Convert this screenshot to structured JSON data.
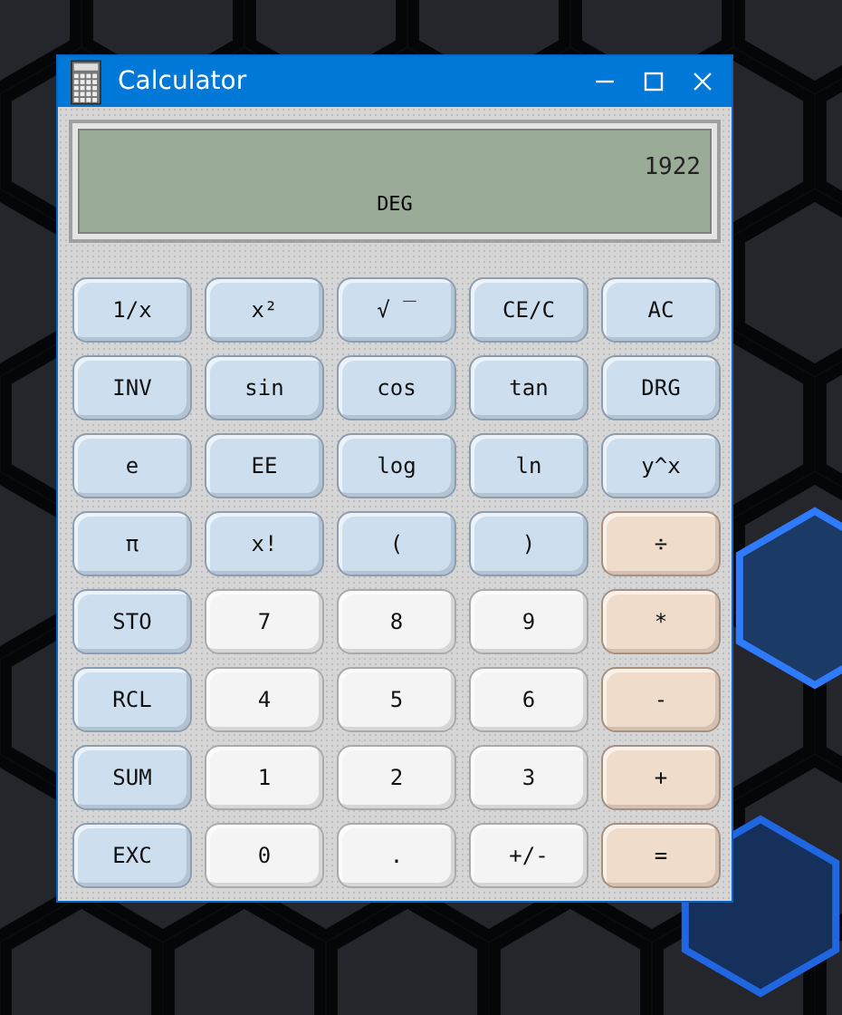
{
  "window": {
    "title": "Calculator"
  },
  "display": {
    "value": "1922",
    "mode": "DEG"
  },
  "keys": [
    {
      "label": "1/x",
      "kind": "function"
    },
    {
      "label": "x²",
      "kind": "function"
    },
    {
      "label": "√ ‾",
      "kind": "function"
    },
    {
      "label": "CE/C",
      "kind": "function"
    },
    {
      "label": "AC",
      "kind": "function"
    },
    {
      "label": "INV",
      "kind": "function"
    },
    {
      "label": "sin",
      "kind": "function"
    },
    {
      "label": "cos",
      "kind": "function"
    },
    {
      "label": "tan",
      "kind": "function"
    },
    {
      "label": "DRG",
      "kind": "function"
    },
    {
      "label": "e",
      "kind": "function"
    },
    {
      "label": "EE",
      "kind": "function"
    },
    {
      "label": "log",
      "kind": "function"
    },
    {
      "label": "ln",
      "kind": "function"
    },
    {
      "label": "y^x",
      "kind": "function"
    },
    {
      "label": "π",
      "kind": "function"
    },
    {
      "label": "x!",
      "kind": "function"
    },
    {
      "label": "(",
      "kind": "function"
    },
    {
      "label": ")",
      "kind": "function"
    },
    {
      "label": "÷",
      "kind": "operator"
    },
    {
      "label": "STO",
      "kind": "function"
    },
    {
      "label": "7",
      "kind": "digit"
    },
    {
      "label": "8",
      "kind": "digit"
    },
    {
      "label": "9",
      "kind": "digit"
    },
    {
      "label": "*",
      "kind": "operator"
    },
    {
      "label": "RCL",
      "kind": "function"
    },
    {
      "label": "4",
      "kind": "digit"
    },
    {
      "label": "5",
      "kind": "digit"
    },
    {
      "label": "6",
      "kind": "digit"
    },
    {
      "label": "-",
      "kind": "operator"
    },
    {
      "label": "SUM",
      "kind": "function"
    },
    {
      "label": "1",
      "kind": "digit"
    },
    {
      "label": "2",
      "kind": "digit"
    },
    {
      "label": "3",
      "kind": "digit"
    },
    {
      "label": "+",
      "kind": "operator"
    },
    {
      "label": "EXC",
      "kind": "function"
    },
    {
      "label": "0",
      "kind": "digit"
    },
    {
      "label": ".",
      "kind": "digit"
    },
    {
      "label": "+/-",
      "kind": "digit"
    },
    {
      "label": "=",
      "kind": "operator"
    }
  ]
}
